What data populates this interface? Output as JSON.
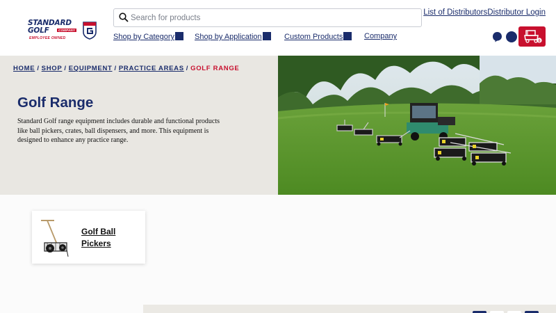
{
  "header": {
    "logo": {
      "line1": "STANDARD",
      "line2": "GOLF",
      "company": "COMPANY",
      "tagline": "EMPLOYEE OWNED",
      "shield_letter": "G"
    },
    "search": {
      "placeholder": "Search for products",
      "icon": "search-icon"
    },
    "top_links": [
      "List of Distributors",
      "Distributor Login"
    ],
    "nav": [
      {
        "label": "Shop by Category",
        "has_dropdown": true
      },
      {
        "label": "Shop by Application",
        "has_dropdown": true
      },
      {
        "label": "Custom Products",
        "has_dropdown": true
      },
      {
        "label": "Company",
        "has_dropdown": false
      }
    ],
    "icons": [
      "account-icon",
      "globe-icon",
      "cart-icon"
    ]
  },
  "breadcrumb": {
    "items": [
      "HOME",
      "SHOP",
      "EQUIPMENT",
      "PRACTICE AREAS"
    ],
    "separator": "/",
    "current": "GOLF RANGE"
  },
  "hero": {
    "title": "Golf Range",
    "description": "Standard Golf range equipment includes durable and functional products like ball pickers, crates, ball dispensers, and more. This equipment is designed to enhance any practice range."
  },
  "categories": [
    {
      "label": "Golf Ball Pickers"
    }
  ],
  "colors": {
    "brand_navy": "#1a2c6b",
    "brand_red": "#c8102e",
    "hero_bg": "#e9e7e2"
  }
}
